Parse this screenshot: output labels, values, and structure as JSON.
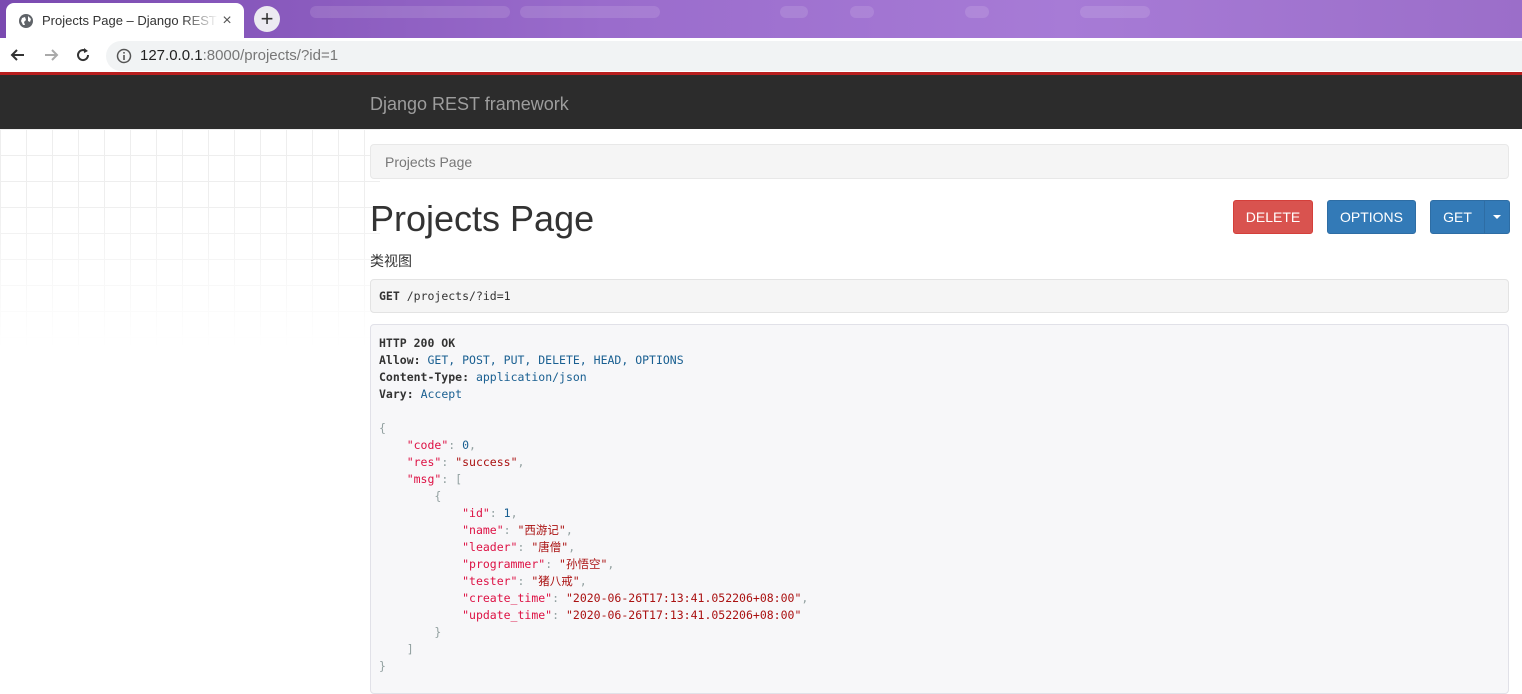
{
  "browser": {
    "tab_title": "Projects Page – Django REST framework",
    "tab_close": "×",
    "new_tab": "+",
    "url_host": "127.0.0.1",
    "url_rest": ":8000/projects/?id=1"
  },
  "header": {
    "brand": "Django REST framework"
  },
  "breadcrumb": {
    "item": "Projects Page"
  },
  "page": {
    "title": "Projects Page",
    "description": "类视图"
  },
  "buttons": {
    "delete": "DELETE",
    "options": "OPTIONS",
    "get": "GET"
  },
  "request": {
    "method": "GET",
    "path": "/projects/?id=1"
  },
  "response": {
    "status": "HTTP 200 OK",
    "headers": [
      {
        "name": "Allow:",
        "value": "GET, POST, PUT, DELETE, HEAD, OPTIONS"
      },
      {
        "name": "Content-Type:",
        "value": "application/json"
      },
      {
        "name": "Vary:",
        "value": "Accept"
      }
    ],
    "body": {
      "code": "0",
      "res": "\"success\"",
      "msg_item": {
        "id": "1",
        "name": "\"西游记\"",
        "leader": "\"唐僧\"",
        "programmer": "\"孙悟空\"",
        "tester": "\"猪八戒\"",
        "create_time": "\"2020-06-26T17:13:41.052206+08:00\"",
        "update_time": "\"2020-06-26T17:13:41.052206+08:00\""
      }
    }
  },
  "colors": {
    "navbar": "#2c2c2c",
    "delete": "#d9534f",
    "primary": "#337ab7",
    "accent_line": "#b81e1e"
  }
}
